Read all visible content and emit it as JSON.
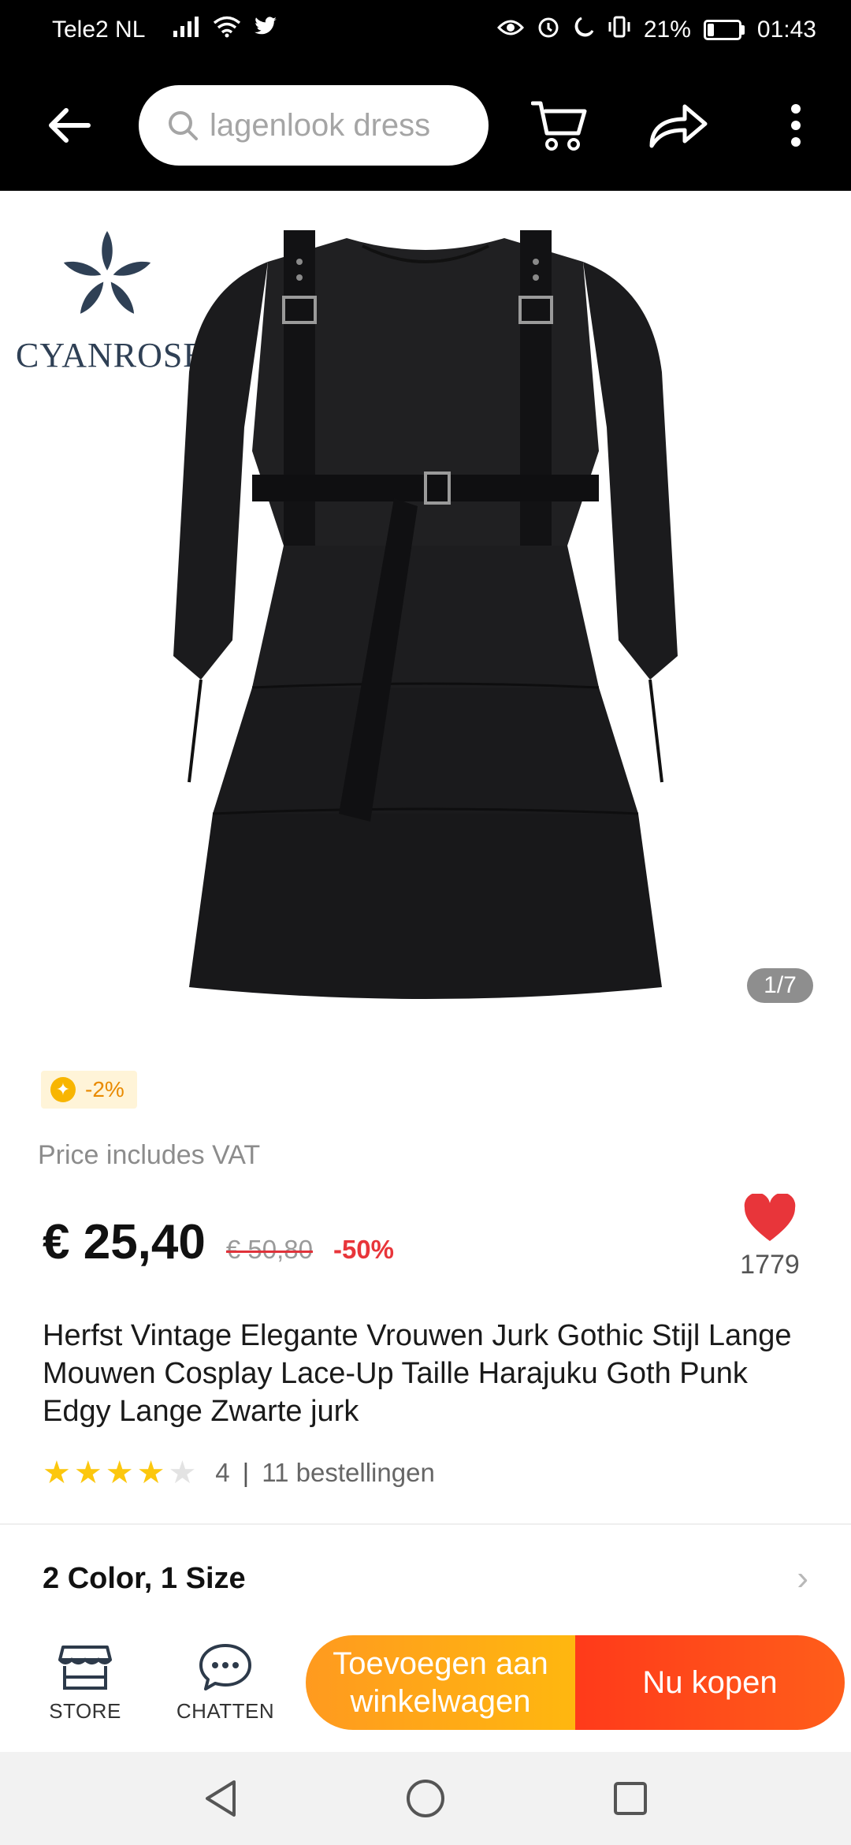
{
  "status_bar": {
    "carrier": "Tele2 NL",
    "battery": "21%",
    "battery_fraction": 0.21,
    "time": "01:43"
  },
  "top_bar": {
    "search_placeholder": "lagenlook dress",
    "icons": [
      "back-arrow-icon",
      "search-icon",
      "cart-icon",
      "share-icon",
      "more-icon"
    ]
  },
  "gallery": {
    "brand_name": "CYANROSE",
    "counter": "1/7"
  },
  "coupon": {
    "label": "-2%",
    "color": "#e98a00"
  },
  "product": {
    "vat_note": "Price includes VAT",
    "price_current": "€ 25,40",
    "price_original": "€ 50,80",
    "discount": "-50%",
    "wishlist_count": "1779",
    "title": "Herfst Vintage Elegante Vrouwen Jurk Gothic Stijl Lange Mouwen Cosplay Lace-Up Taille Harajuku Goth Punk Edgy Lange Zwarte jurk",
    "rating": "4",
    "rating_stars": 4,
    "orders": "11 bestellingen",
    "variants": "2 Color, 1 Size"
  },
  "action_bar": {
    "store_label": "STORE",
    "chat_label": "CHATTEN",
    "add_to_cart": "Toevoegen aan winkelwagen",
    "buy_now": "Nu kopen"
  },
  "colors": {
    "accent_orange": "#ffa31a",
    "accent_red": "#ff4a1a",
    "discount_red": "#e8353a",
    "heart": "#e8353a",
    "star": "#fcc70e"
  }
}
